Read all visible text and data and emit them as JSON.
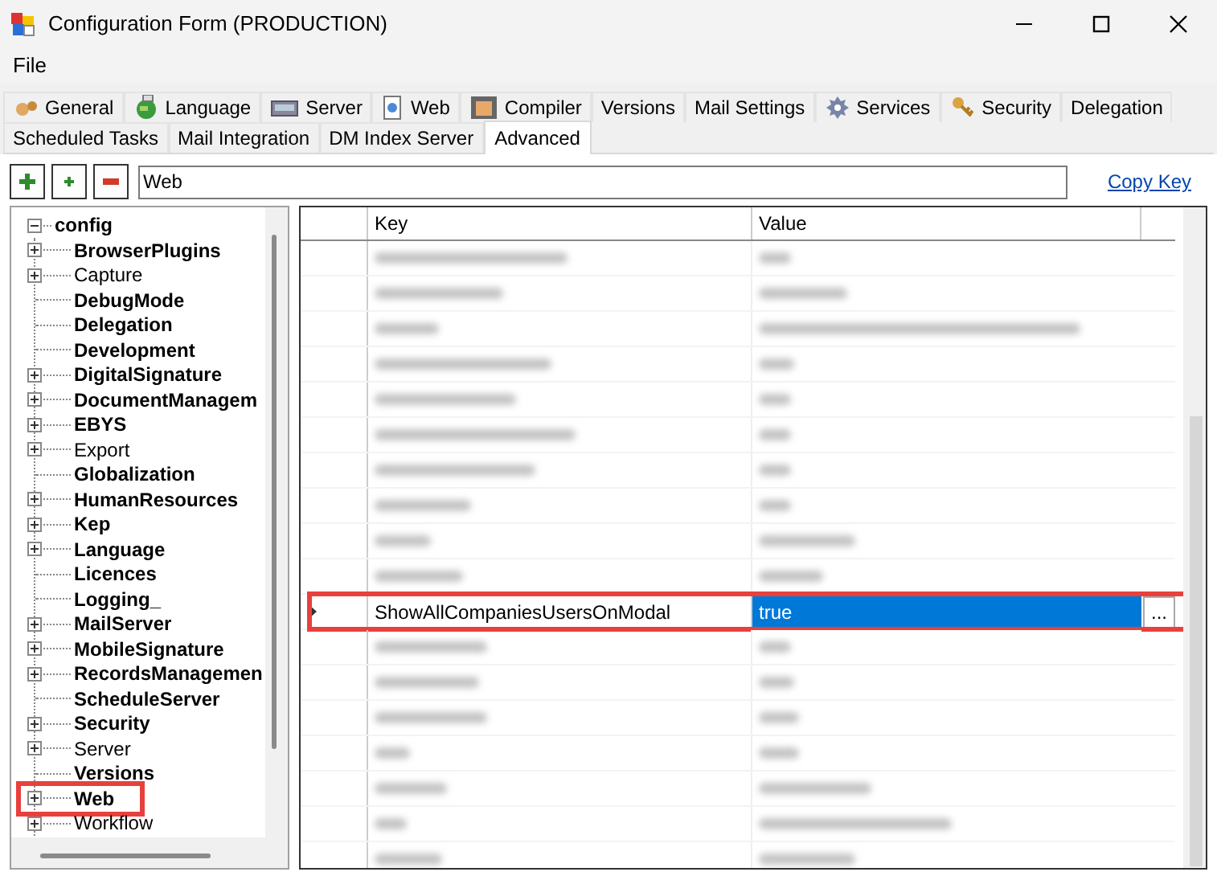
{
  "window": {
    "title": "Configuration Form (PRODUCTION)"
  },
  "menu": [
    "File"
  ],
  "tabs": [
    {
      "label": "General",
      "kind": "with-icon",
      "selected": false
    },
    {
      "label": "Language",
      "kind": "with-icon",
      "selected": false
    },
    {
      "label": "Server",
      "kind": "with-icon",
      "selected": false
    },
    {
      "label": "Web",
      "kind": "with-icon",
      "selected": false
    },
    {
      "label": "Compiler",
      "kind": "with-icon",
      "selected": false
    },
    {
      "label": "Versions",
      "kind": "plain",
      "selected": false
    },
    {
      "label": "Mail Settings",
      "kind": "plain",
      "selected": false
    },
    {
      "label": "Services",
      "kind": "with-icon",
      "selected": false
    },
    {
      "label": "Security",
      "kind": "with-icon",
      "selected": false
    },
    {
      "label": "Delegation",
      "kind": "plain",
      "selected": false
    },
    {
      "label": "Scheduled Tasks",
      "kind": "plain",
      "selected": false
    },
    {
      "label": "Mail Integration",
      "kind": "plain",
      "selected": false
    },
    {
      "label": "DM Index Server",
      "kind": "plain",
      "selected": false
    },
    {
      "label": "Advanced",
      "kind": "plain",
      "selected": true
    }
  ],
  "toolbar": {
    "buttons": [
      {
        "kind": "add-big"
      },
      {
        "kind": "add-small"
      },
      {
        "kind": "remove"
      }
    ],
    "path_value": "Web",
    "link": "Copy Key"
  },
  "tree": {
    "label": "config",
    "expanded": true,
    "children": [
      {
        "label": "BrowserPlugins",
        "bold": true,
        "expandable": true,
        "marked": false
      },
      {
        "label": "Capture",
        "bold": false,
        "expandable": true,
        "marked": false
      },
      {
        "label": "DebugMode",
        "bold": true,
        "expandable": false,
        "marked": false
      },
      {
        "label": "Delegation",
        "bold": true,
        "expandable": false,
        "marked": false
      },
      {
        "label": "Development",
        "bold": true,
        "expandable": false,
        "marked": false
      },
      {
        "label": "DigitalSignature",
        "bold": true,
        "expandable": true,
        "marked": false
      },
      {
        "label": "DocumentManagem",
        "bold": true,
        "expandable": true,
        "marked": false
      },
      {
        "label": "EBYS",
        "bold": true,
        "expandable": true,
        "marked": false
      },
      {
        "label": "Export",
        "bold": false,
        "expandable": true,
        "marked": false
      },
      {
        "label": "Globalization",
        "bold": true,
        "expandable": false,
        "marked": false
      },
      {
        "label": "HumanResources",
        "bold": true,
        "expandable": true,
        "marked": false
      },
      {
        "label": "Kep",
        "bold": true,
        "expandable": true,
        "marked": false
      },
      {
        "label": "Language",
        "bold": true,
        "expandable": true,
        "marked": false
      },
      {
        "label": "Licences",
        "bold": true,
        "expandable": false,
        "marked": false
      },
      {
        "label": "Logging_",
        "bold": true,
        "expandable": false,
        "marked": false
      },
      {
        "label": "MailServer",
        "bold": true,
        "expandable": true,
        "marked": false
      },
      {
        "label": "MobileSignature",
        "bold": true,
        "expandable": true,
        "marked": false
      },
      {
        "label": "RecordsManagemen",
        "bold": true,
        "expandable": true,
        "marked": false
      },
      {
        "label": "ScheduleServer",
        "bold": true,
        "expandable": false,
        "marked": false
      },
      {
        "label": "Security",
        "bold": true,
        "expandable": true,
        "marked": false
      },
      {
        "label": "Server",
        "bold": false,
        "expandable": true,
        "marked": false
      },
      {
        "label": "Versions",
        "bold": true,
        "expandable": false,
        "marked": false
      },
      {
        "label": "Web",
        "bold": true,
        "expandable": true,
        "marked": true
      },
      {
        "label": "Workflow",
        "bold": false,
        "expandable": true,
        "marked": false
      }
    ]
  },
  "grid": {
    "columns": [
      "Key",
      "Value"
    ],
    "rows": [
      {
        "kind": "blurred",
        "selected": false
      },
      {
        "kind": "blurred",
        "selected": false
      },
      {
        "kind": "blurred",
        "selected": false
      },
      {
        "kind": "blurred",
        "selected": false
      },
      {
        "kind": "blurred",
        "selected": false
      },
      {
        "kind": "blurred",
        "selected": false
      },
      {
        "kind": "blurred",
        "selected": false
      },
      {
        "kind": "blurred",
        "selected": false
      },
      {
        "kind": "blurred",
        "selected": false
      },
      {
        "kind": "blurred",
        "selected": false
      },
      {
        "kind": "entry",
        "key": "ShowAllCompaniesUsersOnModal",
        "value": "true",
        "button": "...",
        "selected": true,
        "marked": true
      },
      {
        "kind": "blurred",
        "selected": false
      },
      {
        "kind": "blurred",
        "selected": false
      },
      {
        "kind": "blurred",
        "selected": false
      },
      {
        "kind": "blurred",
        "selected": false
      },
      {
        "kind": "blurred",
        "selected": false
      },
      {
        "kind": "blurred",
        "selected": false
      },
      {
        "kind": "blurred",
        "selected": false
      }
    ]
  }
}
